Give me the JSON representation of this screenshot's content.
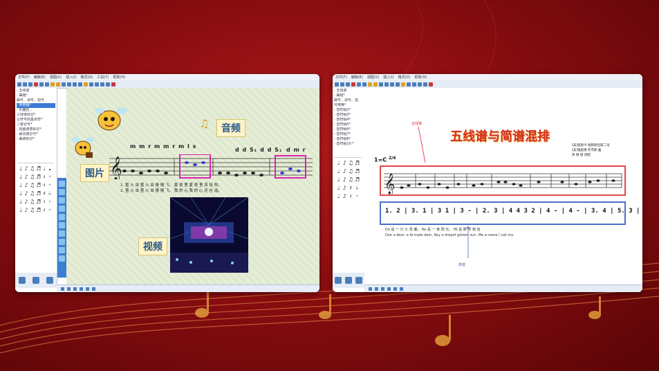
{
  "left_window": {
    "menu": [
      "文件(F)",
      "编辑(E)",
      "视图(V)",
      "插入(I)",
      "格式(O)",
      "工具(T)",
      "帮助(H)"
    ],
    "tree": [
      "- 五线谱",
      "  - 曲题*",
      "    曲号、调号、拍号",
      "  - 常用器*",
      "  - 乐器名...",
      "    三线谱标记*",
      "    以符号的基本符*",
      "    二度记号*",
      "  - 完整谱表标记*",
      "  - 歌词谱记号*",
      "  - 曲谱标记*"
    ],
    "tree_selected_index": 3,
    "labels": {
      "picture": "图片",
      "audio": "音频",
      "video": "视频"
    },
    "solfa_1": "m m r m m r m  l  s",
    "solfa_2": "d d S₁ d d S₁",
    "solfa_3": "d m r",
    "lyric_line_1": "1. 萤 火 虫 萤 火 虫    慢 慢 飞，   夏 夜 里 夏 夜 里    风 轻 吹。",
    "lyric_line_2": "2. 萤 火 虫 萤 火 虫    慢 慢 飞，   我 的 心 我 的 心    还 在 追。"
  },
  "right_window": {
    "menu": [
      "文件(F)",
      "编辑(E)",
      "视图(V)",
      "插入(I)",
      "格式(O)",
      "帮助(H)"
    ],
    "tree": [
      "- 五线谱",
      "  - 曲题*",
      "    曲号、调号、拍",
      "    号用等*",
      "  - 音符组2*",
      "  - 音符组3*",
      "  - 音符组4*",
      "  - 音符组5*",
      "  - 音符组6*",
      "  - 音符组7*",
      "  - 音符组8*",
      "  - 音符组10 *"
    ],
    "title": "五线谱与简谱混排",
    "annotation_staff": "五线谱",
    "annotation_jianpu": "简谱",
    "credits": [
      "[美]奥斯卡·哈默斯坦第二词",
      "[美]理查德·罗杰斯 曲",
      "贺  锡  德  译配"
    ],
    "key_signature": "1=C",
    "time_signature": "2/4",
    "jianpu": "1. 2 | 3. 1 | 3 1 | 3 - | 2. 3 | 4 4 3 2 | 4 - | 4 - | 3. 4 | 5. 3 | 5 3",
    "lyrics_cn": "Do    是    一  只   小  母   鹿，    Re   是   一  束  阳     光，         Mi   是   那    呼    我   自",
    "lyrics_en": "Doe   a    deer, a     fe-male deer,    Rey  a   dropof golden   sun,          Me   a   name   I    call  my-"
  }
}
